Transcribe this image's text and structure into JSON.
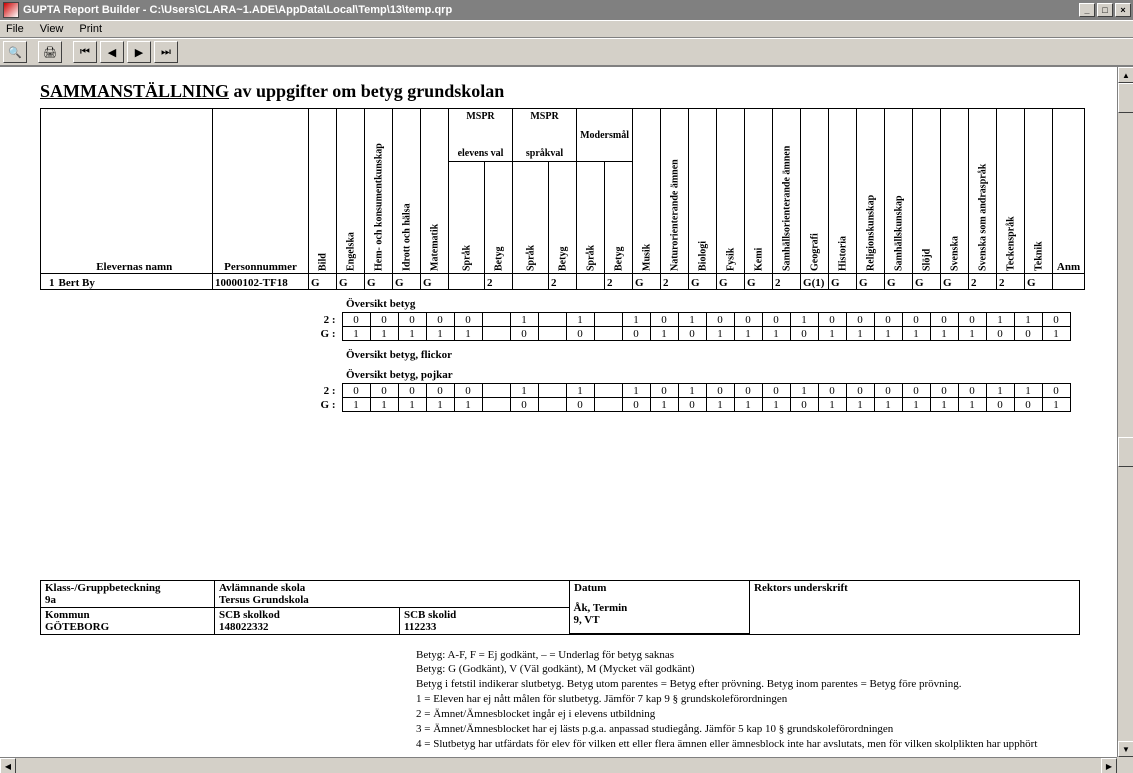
{
  "window": {
    "title": "GUPTA Report Builder - C:\\Users\\CLARA~1.ADE\\AppData\\Local\\Temp\\13\\temp.qrp",
    "menus": [
      "File",
      "View",
      "Print"
    ]
  },
  "report_title": {
    "lead": "SAMMANSTÄLLNING",
    "rest": " av uppgifter om betyg grundskolan"
  },
  "headers": {
    "row_no": "",
    "name": "Elevernas namn",
    "pn": "Personnummer",
    "subjects": [
      "Bild",
      "Engelska",
      "Hem- och konsumentkunskap",
      "Idrott och hälsa",
      "Matematik",
      "Språk",
      "Betyg",
      "Språk",
      "Betyg",
      "Språk",
      "Betyg",
      "Musik",
      "Naturorienterande ämnen",
      "Biologi",
      "Fysik",
      "Kemi",
      "Samhällsorienterande ämnen",
      "Geografi",
      "Historia",
      "Religionskunskap",
      "Samhällskunskap",
      "Slöjd",
      "Svenska",
      "Svenska som andraspråk",
      "Teckenspråk",
      "Teknik"
    ],
    "groups": {
      "mspr1": "MSPR",
      "elevens": "elevens val",
      "mspr2": "MSPR",
      "sprakval": "språkval",
      "modersmal": "Modersmål"
    },
    "anm": "Anm"
  },
  "rows": [
    {
      "no": "1",
      "name": "Bert By",
      "pn": "10000102-TF18",
      "cells": [
        "G",
        "G",
        "G",
        "G",
        "G",
        "",
        "2",
        "",
        "2",
        "",
        "2",
        "G",
        "2",
        "G",
        "G",
        "G",
        "2",
        "G(1)",
        "G",
        "G",
        "G",
        "G",
        "G",
        "2",
        "2",
        "G"
      ],
      "anm": ""
    }
  ],
  "overview": {
    "title1": "Översikt betyg",
    "title_flick": "Översikt betyg, flickor",
    "title_pojk": "Översikt betyg, pojkar",
    "row2": [
      "0",
      "0",
      "0",
      "0",
      "0",
      "",
      "1",
      "",
      "1",
      "",
      "1",
      "0",
      "1",
      "0",
      "0",
      "0",
      "1",
      "0",
      "0",
      "0",
      "0",
      "0",
      "0",
      "1",
      "1",
      "0"
    ],
    "rowG": [
      "1",
      "1",
      "1",
      "1",
      "1",
      "",
      "0",
      "",
      "0",
      "",
      "0",
      "1",
      "0",
      "1",
      "1",
      "1",
      "0",
      "1",
      "1",
      "1",
      "1",
      "1",
      "1",
      "0",
      "0",
      "1"
    ],
    "pojk2": [
      "0",
      "0",
      "0",
      "0",
      "0",
      "",
      "1",
      "",
      "1",
      "",
      "1",
      "0",
      "1",
      "0",
      "0",
      "0",
      "1",
      "0",
      "0",
      "0",
      "0",
      "0",
      "0",
      "1",
      "1",
      "0"
    ],
    "pojkG": [
      "1",
      "1",
      "1",
      "1",
      "1",
      "",
      "0",
      "",
      "0",
      "",
      "0",
      "1",
      "0",
      "1",
      "1",
      "1",
      "0",
      "1",
      "1",
      "1",
      "1",
      "1",
      "1",
      "0",
      "0",
      "1"
    ],
    "labels": {
      "two": "2 :",
      "g": "G :"
    }
  },
  "footer": {
    "klass_lbl": "Klass-/Gruppbeteckning",
    "klass": "9a",
    "skola_lbl": "Avlämnande skola",
    "skola": "Tersus Grundskola",
    "datum_lbl": "Datum",
    "rektor_lbl": "Rektors underskrift",
    "kommun_lbl": "Kommun",
    "kommun": "GÖTEBORG",
    "scbkod_lbl": "SCB skolkod",
    "scbkod": "148022332",
    "scbid_lbl": "SCB skolid",
    "scbid": "112233",
    "ak_lbl": "Åk, Termin",
    "ak": "9, VT"
  },
  "legend": [
    "Betyg: A-F, F = Ej godkänt, – = Underlag för betyg saknas",
    "Betyg: G (Godkänt), V (Väl godkänt), M (Mycket väl godkänt)",
    "Betyg i fetstil indikerar slutbetyg. Betyg utom parentes = Betyg efter prövning. Betyg inom parentes = Betyg före prövning.",
    "1 = Eleven har ej nått målen för slutbetyg. Jämför 7 kap 9 § grundskoleförordningen",
    "2 = Ämnet/Ämnesblocket ingår ej i elevens utbildning",
    "3 = Ämnet/Ämnesblocket har ej lästs p.g.a. anpassad studiegång. Jämför 5 kap 10 § grundskoleförordningen",
    "4 = Slutbetyg har utfärdats för elev för vilken ett eller flera ämnen eller ämnesblock inte har avslutats, men för vilken skolplikten har upphört"
  ]
}
